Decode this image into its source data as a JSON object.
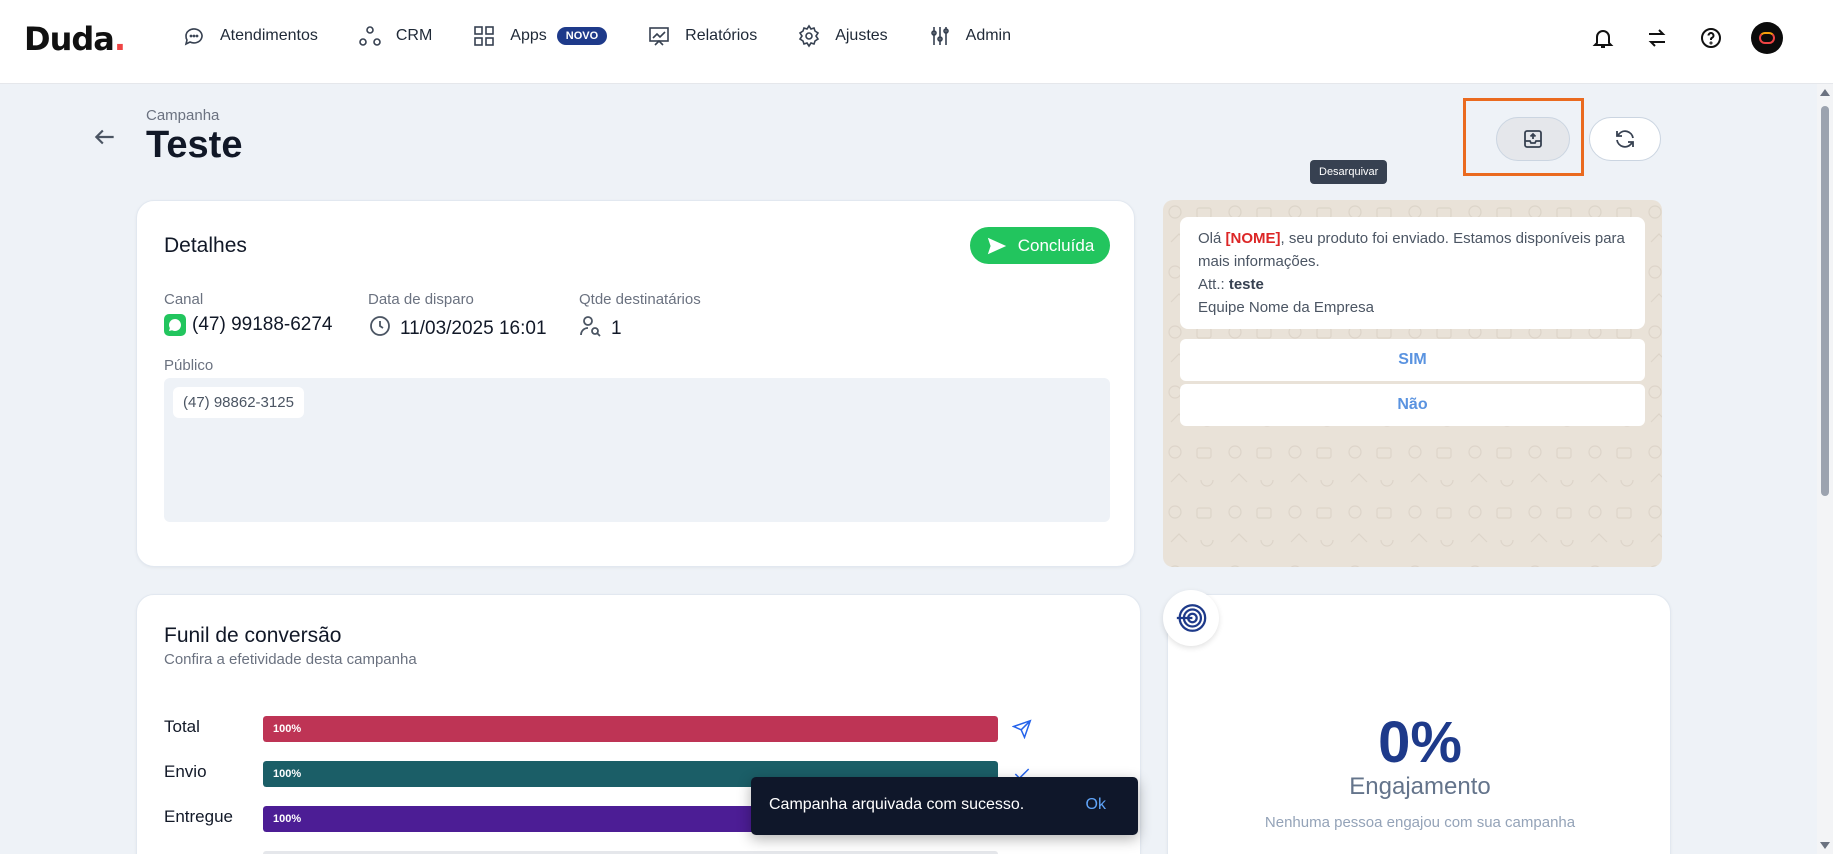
{
  "brand": {
    "logo": "Duda",
    "logo_dot": "."
  },
  "nav": {
    "items": [
      {
        "label": "Atendimentos",
        "icon": "chat-icon"
      },
      {
        "label": "CRM",
        "icon": "nodes-icon"
      },
      {
        "label": "Apps",
        "icon": "grid-icon",
        "badge": "NOVO"
      },
      {
        "label": "Relatórios",
        "icon": "chart-icon"
      },
      {
        "label": "Ajustes",
        "icon": "gear-icon"
      },
      {
        "label": "Admin",
        "icon": "sliders-icon"
      }
    ]
  },
  "topbar_icons": [
    "bell-icon",
    "transfer-icon",
    "help-icon",
    "avatar"
  ],
  "header": {
    "crumb": "Campanha",
    "title": "Teste",
    "tooltip": "Desarquivar"
  },
  "details": {
    "title": "Detalhes",
    "status": "Concluída",
    "canal_label": "Canal",
    "canal_value": "(47) 99188-6274",
    "data_label": "Data de disparo",
    "data_value": "11/03/2025 16:01",
    "qtde_label": "Qtde destinatários",
    "qtde_value": "1",
    "publico_label": "Público",
    "publico_chip": "(47) 98862-3125"
  },
  "preview": {
    "line1_pre": "Olá ",
    "line1_var": "[NOME]",
    "line1_post": ", seu produto foi enviado. Estamos disponíveis para mais informações.",
    "line2_pre": "Att.: ",
    "line2_bold": "teste",
    "line3": "Equipe Nome da Empresa",
    "reply_1": "SIM",
    "reply_2": "Não"
  },
  "funnel": {
    "title": "Funil de conversão",
    "subtitle": "Confira a efetividade desta campanha",
    "rows": [
      {
        "label": "Total",
        "value": "100%",
        "fraction": 1.0,
        "color": "#be3455",
        "icon": "send-icon"
      },
      {
        "label": "Envio",
        "value": "100%",
        "fraction": 1.0,
        "color": "#1b5e67",
        "icon": "check-icon"
      },
      {
        "label": "Entregue",
        "value": "100%",
        "fraction": 1.0,
        "color": "#4c1d95",
        "icon": "double-check-icon"
      }
    ]
  },
  "engagement": {
    "value": "0%",
    "label": "Engajamento",
    "subtitle": "Nenhuma pessoa engajou com sua campanha"
  },
  "toast": {
    "message": "Campanha arquivada com sucesso.",
    "action": "Ok"
  },
  "colors": {
    "accent_orange": "#ea6a1f",
    "success_green": "#22c55e",
    "brand_navy": "#1e3a8a",
    "whatsapp_bg": "#e9e2d8"
  }
}
